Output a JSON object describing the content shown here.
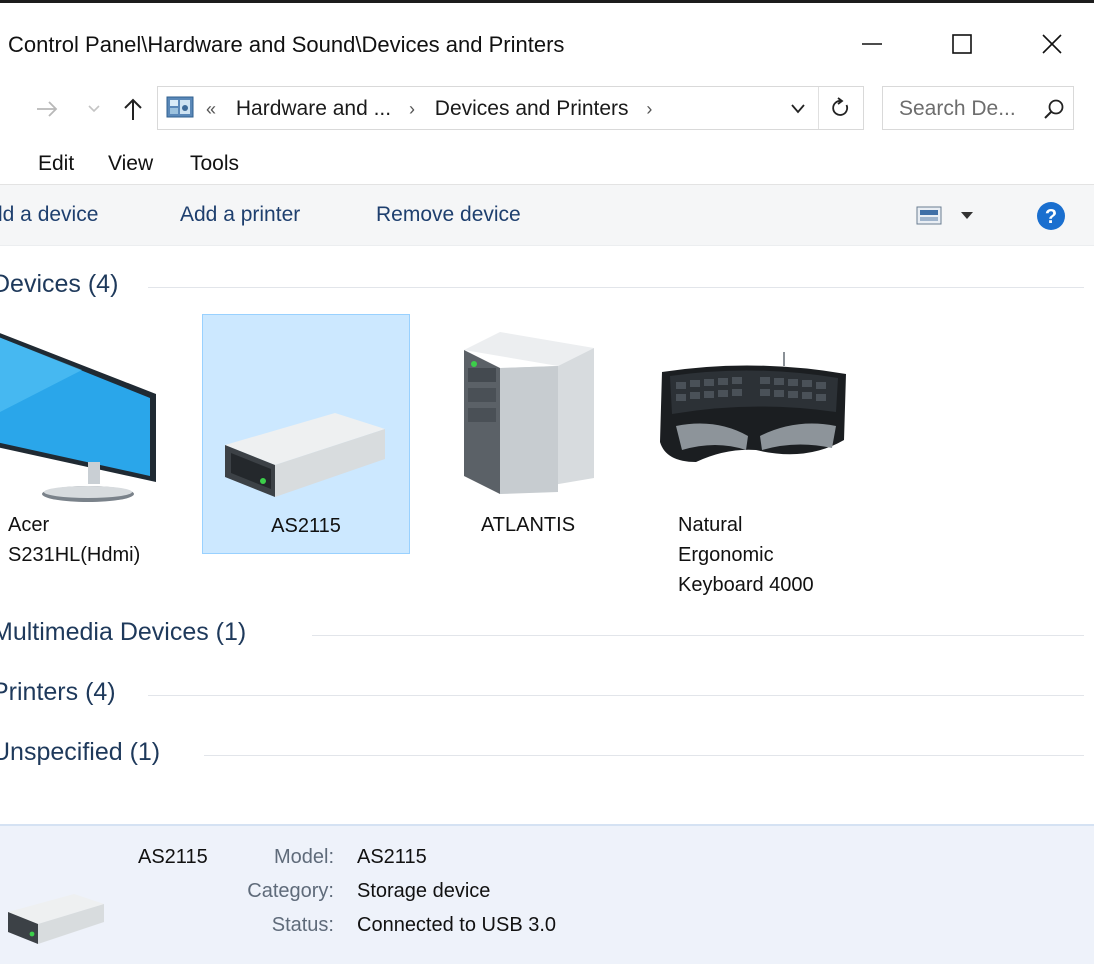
{
  "window": {
    "title": "Control Panel\\Hardware and Sound\\Devices and Printers"
  },
  "address": {
    "overflow": "«",
    "crumbs": [
      "Hardware and ...",
      "Devices and Printers"
    ],
    "search_placeholder": "Search De..."
  },
  "menu": {
    "items": [
      "Edit",
      "View",
      "Tools"
    ]
  },
  "commands": {
    "add_device": "ld a device",
    "add_printer": "Add a printer",
    "remove_device": "Remove device"
  },
  "groups": {
    "devices": "Devices (4)",
    "multimedia": "Multimedia Devices (1)",
    "printers": "Printers (4)",
    "unspecified": "Unspecified (1)"
  },
  "devices": [
    {
      "name_line1": "Acer",
      "name_line2": "S231HL(Hdmi)",
      "icon": "monitor-icon"
    },
    {
      "name": "AS2115",
      "icon": "external-drive-icon",
      "selected": true
    },
    {
      "name": "ATLANTIS",
      "icon": "computer-tower-icon"
    },
    {
      "name_line1": "Natural",
      "name_line2": "Ergonomic",
      "name_line3": "Keyboard 4000",
      "icon": "keyboard-icon"
    }
  ],
  "details": {
    "name": "AS2115",
    "model_label": "Model:",
    "model_value": "AS2115",
    "category_label": "Category:",
    "category_value": "Storage device",
    "status_label": "Status:",
    "status_value": "Connected to USB 3.0"
  },
  "colors": {
    "accent": "#1e395b",
    "selection_fill": "#cce8ff",
    "selection_border": "#99d1ff",
    "help_blue": "#1a6fcf",
    "details_bg": "#eef2fa"
  }
}
